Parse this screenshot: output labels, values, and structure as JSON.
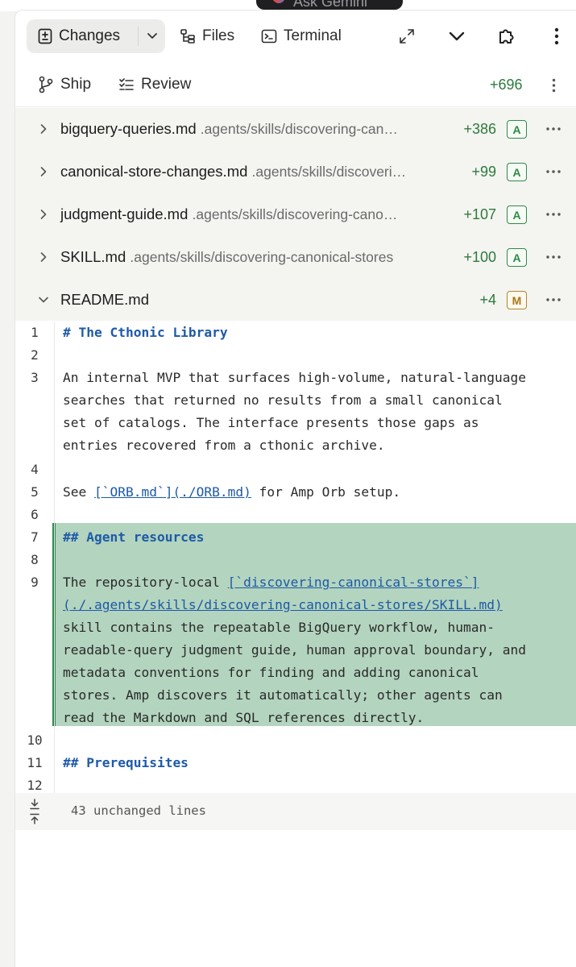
{
  "header_peek": {
    "gemini_label": "Ask Gemini"
  },
  "toolbar": {
    "changes_label": "Changes",
    "files_label": "Files",
    "terminal_label": "Terminal"
  },
  "subbar": {
    "ship_label": "Ship",
    "review_label": "Review",
    "total_additions": "+696"
  },
  "files": [
    {
      "name": "bigquery-queries.md",
      "path": ".agents/skills/discovering-can…",
      "additions": "+386",
      "status": "A",
      "expanded": false
    },
    {
      "name": "canonical-store-changes.md",
      "path": ".agents/skills/discoveri…",
      "additions": "+99",
      "status": "A",
      "expanded": false
    },
    {
      "name": "judgment-guide.md",
      "path": ".agents/skills/discovering-cano…",
      "additions": "+107",
      "status": "A",
      "expanded": false
    },
    {
      "name": "SKILL.md",
      "path": ".agents/skills/discovering-canonical-stores",
      "additions": "+100",
      "status": "A",
      "expanded": false
    },
    {
      "name": "README.md",
      "path": "",
      "additions": "+4",
      "status": "M",
      "expanded": true
    }
  ],
  "diff": {
    "line_numbers": [
      "1",
      "2",
      "3",
      "4",
      "5",
      "6",
      "7",
      "8",
      "9",
      "10",
      "11",
      "12"
    ],
    "l1": "# The Cthonic Library",
    "l3a": "An internal MVP that surfaces high-volume, natural-language",
    "l3b": "searches that returned no results from a small canonical",
    "l3c": "set of catalogs. The interface presents those gaps as",
    "l3d": "entries recovered from a cthonic archive.",
    "l5_pre": "See ",
    "l5_link": "[`ORB.md`](./ORB.md)",
    "l5_post": " for Amp Orb setup.",
    "l7": "## Agent resources",
    "l9_pre": "The repository-local ",
    "l9_link1": "[`discovering-canonical-stores`]",
    "l9_link2": "(./.agents/skills/discovering-canonical-stores/SKILL.md)",
    "l9c": "skill contains the repeatable BigQuery workflow, human-",
    "l9d": "readable-query judgment guide, human approval boundary, and",
    "l9e": "metadata conventions for finding and adding canonical",
    "l9f": "stores. Amp discovers it automatically; other agents can",
    "l9g": "read the Markdown and SQL references directly.",
    "l11": "## Prerequisites",
    "unchanged_label": "43 unchanged lines"
  }
}
